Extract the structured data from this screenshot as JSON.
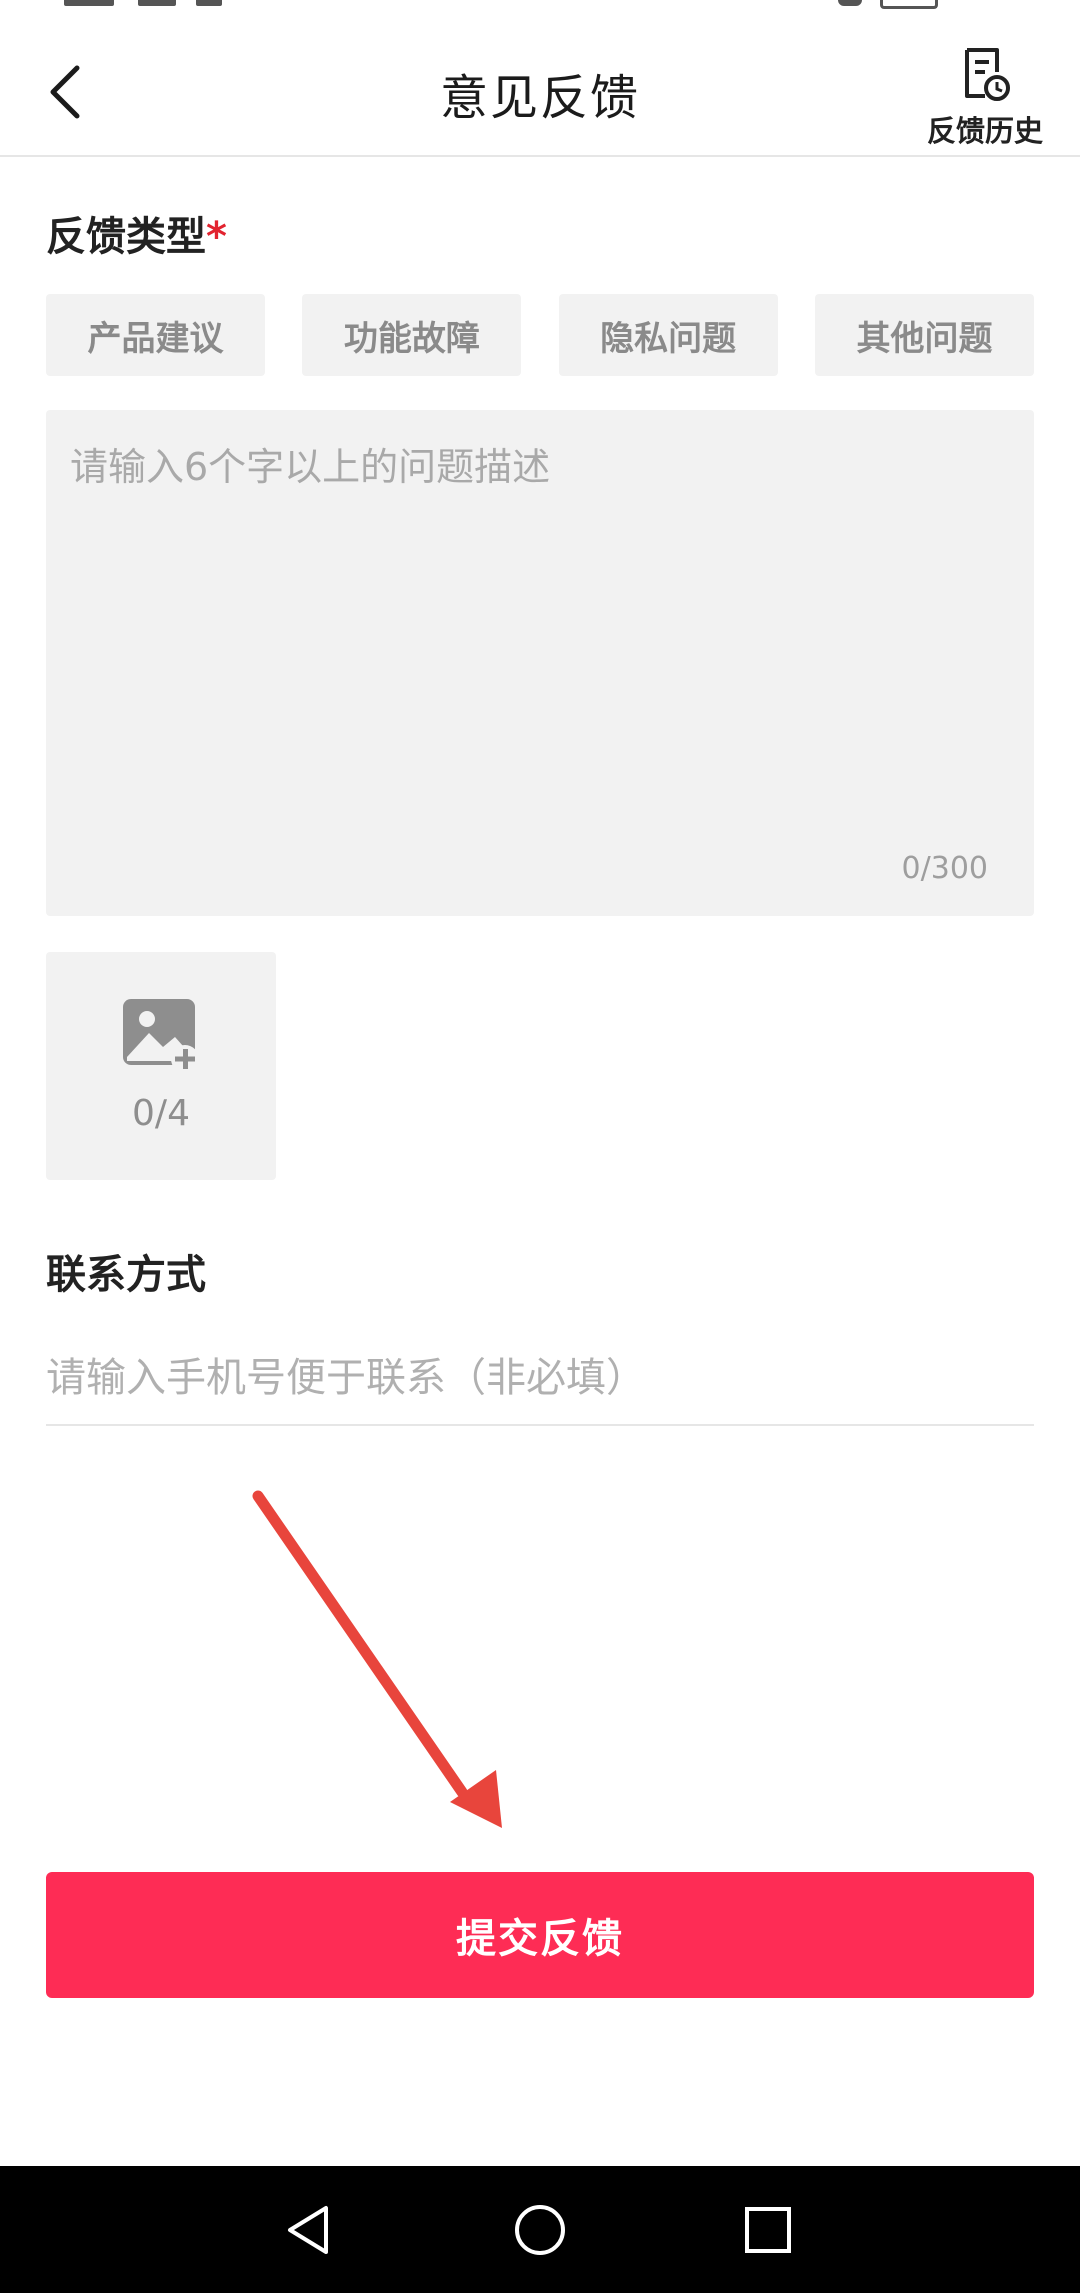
{
  "header": {
    "title": "意见反馈",
    "history_label": "反馈历史"
  },
  "feedback_type": {
    "title": "反馈类型",
    "required_mark": "*",
    "options": [
      "产品建议",
      "功能故障",
      "隐私问题",
      "其他问题"
    ]
  },
  "description": {
    "placeholder": "请输入6个字以上的问题描述",
    "value": "",
    "counter": "0/300"
  },
  "upload": {
    "counter": "0/4"
  },
  "contact": {
    "title": "联系方式",
    "placeholder": "请输入手机号便于联系（非必填）",
    "value": ""
  },
  "submit": {
    "label": "提交反馈"
  },
  "colors": {
    "accent": "#fe2c55",
    "required": "#e2232f",
    "annotation_arrow": "#e8453c"
  },
  "icons": [
    "back-arrow-icon",
    "history-document-clock-icon",
    "add-image-icon",
    "nav-back-icon",
    "nav-home-icon",
    "nav-recents-icon"
  ]
}
